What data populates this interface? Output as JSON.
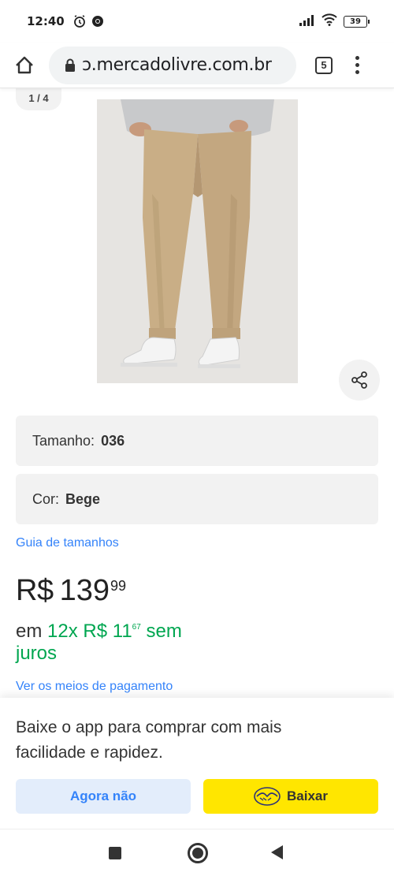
{
  "status_bar": {
    "time": "12:40",
    "battery": "39"
  },
  "browser": {
    "url": "ɔ.mercadolivre.com.br",
    "tab_count": "5"
  },
  "gallery": {
    "counter": "1 / 4"
  },
  "variations": [
    {
      "label": "Tamanho:",
      "value": "036"
    },
    {
      "label": "Cor:",
      "value": "Bege"
    }
  ],
  "size_guide_link": "Guia de tamanhos",
  "price": {
    "currency": "R$",
    "integer": "139",
    "cents": "99",
    "installments_prefix": "em",
    "installments_count": "12x",
    "installment_currency": "R$",
    "installment_integer": "11",
    "installment_cents": "67",
    "installments_suffix": "sem juros"
  },
  "payment_link": "Ver os meios de pagamento",
  "app_banner": {
    "message": "Baixe o app para comprar com mais facilidade e rapidez.",
    "dismiss_label": "Agora não",
    "download_label": "Baixar"
  },
  "colors": {
    "link_blue": "#3483fa",
    "install_green": "#00a650",
    "brand_yellow": "#ffe600",
    "secondary_button_bg": "#e3edfb"
  }
}
